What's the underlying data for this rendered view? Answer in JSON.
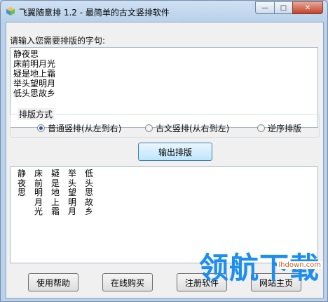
{
  "window": {
    "title": "飞翼随意排 1.2 - 最简单的古文竖排软件"
  },
  "titlebar_buttons": {
    "minimize": "—",
    "maximize": "□",
    "close": "✕"
  },
  "input": {
    "label": "请输入您需要排版的字句:",
    "lines": [
      "静夜思",
      "床前明月光",
      "疑是地上霜",
      "举头望明月",
      "低头思故乡"
    ]
  },
  "layout_group": {
    "legend": "排版方式",
    "options": [
      {
        "label": "普通竖排(从左到右)",
        "selected": true
      },
      {
        "label": "古文竖排(从右到左)",
        "selected": false
      },
      {
        "label": "逆序排版",
        "selected": false
      }
    ]
  },
  "actions": {
    "output": "输出排版"
  },
  "output_columns": [
    "静夜思",
    "床前明月光",
    "疑是地上霜",
    "举头望明月",
    "低头思故乡"
  ],
  "bottom_buttons": {
    "help": "使用帮助",
    "buy": "在线购买",
    "register": "注册软件",
    "site": "网站主页"
  },
  "watermark": {
    "text": "领航下载",
    "url": "lhdown.com"
  },
  "colors": {
    "selected_radio": "#1b5fa0",
    "watermark": "#1c8ef2",
    "watermark_url": "#e05a1c"
  }
}
